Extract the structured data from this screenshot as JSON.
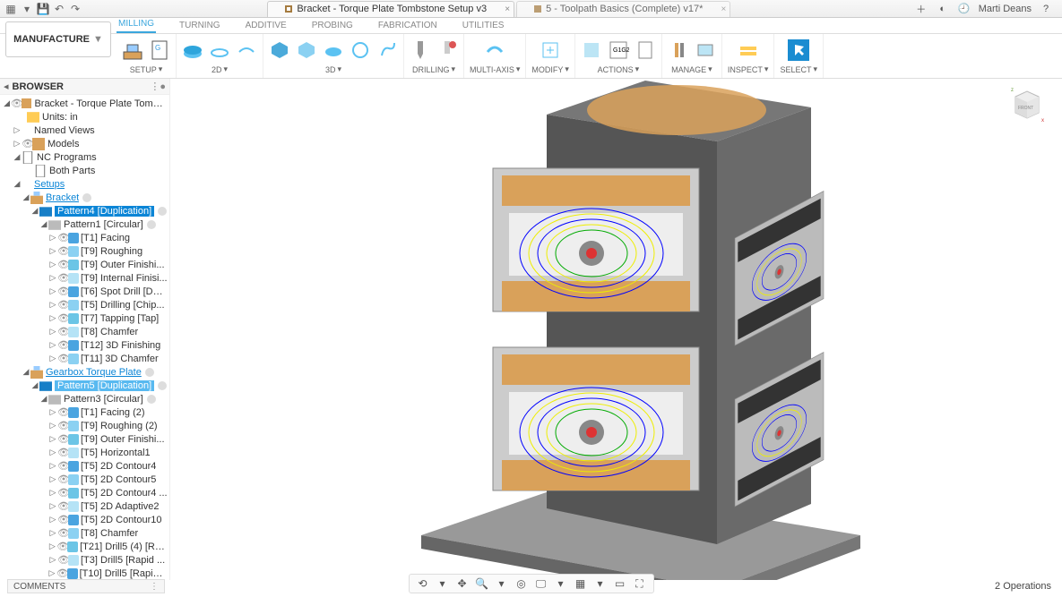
{
  "titlebar": {
    "doc_tab1": "Bracket - Torque Plate Tombstone Setup v3",
    "doc_tab2": "5 - Toolpath Basics (Complete) v17*",
    "user": "Marti Deans"
  },
  "workspace": "MANUFACTURE",
  "ribbon_tabs": [
    "MILLING",
    "TURNING",
    "ADDITIVE",
    "PROBING",
    "FABRICATION",
    "UTILITIES"
  ],
  "ribbon_groups": {
    "setup": "SETUP",
    "d2": "2D",
    "d3": "3D",
    "drilling": "DRILLING",
    "multi": "MULTI-AXIS",
    "modify": "MODIFY",
    "actions": "ACTIONS",
    "manage": "MANAGE",
    "inspect": "INSPECT",
    "select": "SELECT"
  },
  "browser": {
    "title": "BROWSER",
    "root": "Bracket - Torque Plate Tombstone ...",
    "units": "Units: in",
    "named_views": "Named Views",
    "models": "Models",
    "nc_programs": "NC Programs",
    "both_parts": "Both Parts",
    "setups": "Setups",
    "bracket": "Bracket",
    "pattern4": "Pattern4 [Duplication]",
    "pattern1": "Pattern1 [Circular]",
    "ops1": [
      "[T1] Facing",
      "[T9] Roughing",
      "[T9] Outer Finishi...",
      "[T9] Internal Finisi...",
      "[T6] Spot Drill [Dw...",
      "[T5] Drilling [Chip...",
      "[T7] Tapping [Tap]",
      "[T8] Chamfer",
      "[T12] 3D Finishing",
      "[T11] 3D Chamfer"
    ],
    "gearbox": "Gearbox Torque Plate",
    "pattern5": "Pattern5 [Duplication]",
    "pattern3": "Pattern3 [Circular]",
    "ops2": [
      "[T1] Facing (2)",
      "[T9] Roughing (2)",
      "[T9] Outer Finishi...",
      "[T5] Horizontal1",
      "[T5] 2D Contour4",
      "[T5] 2D Contour5",
      "[T5] 2D Contour4 ...",
      "[T5] 2D Adaptive2",
      "[T5] 2D Contour10",
      "[T8] Chamfer",
      "[T21] Drill5 (4) [Ra...",
      "[T3] Drill5 [Rapid ...",
      "[T10] Drill5 [Rapid ..."
    ]
  },
  "comments": "COMMENTS",
  "ops_count": "2 Operations"
}
